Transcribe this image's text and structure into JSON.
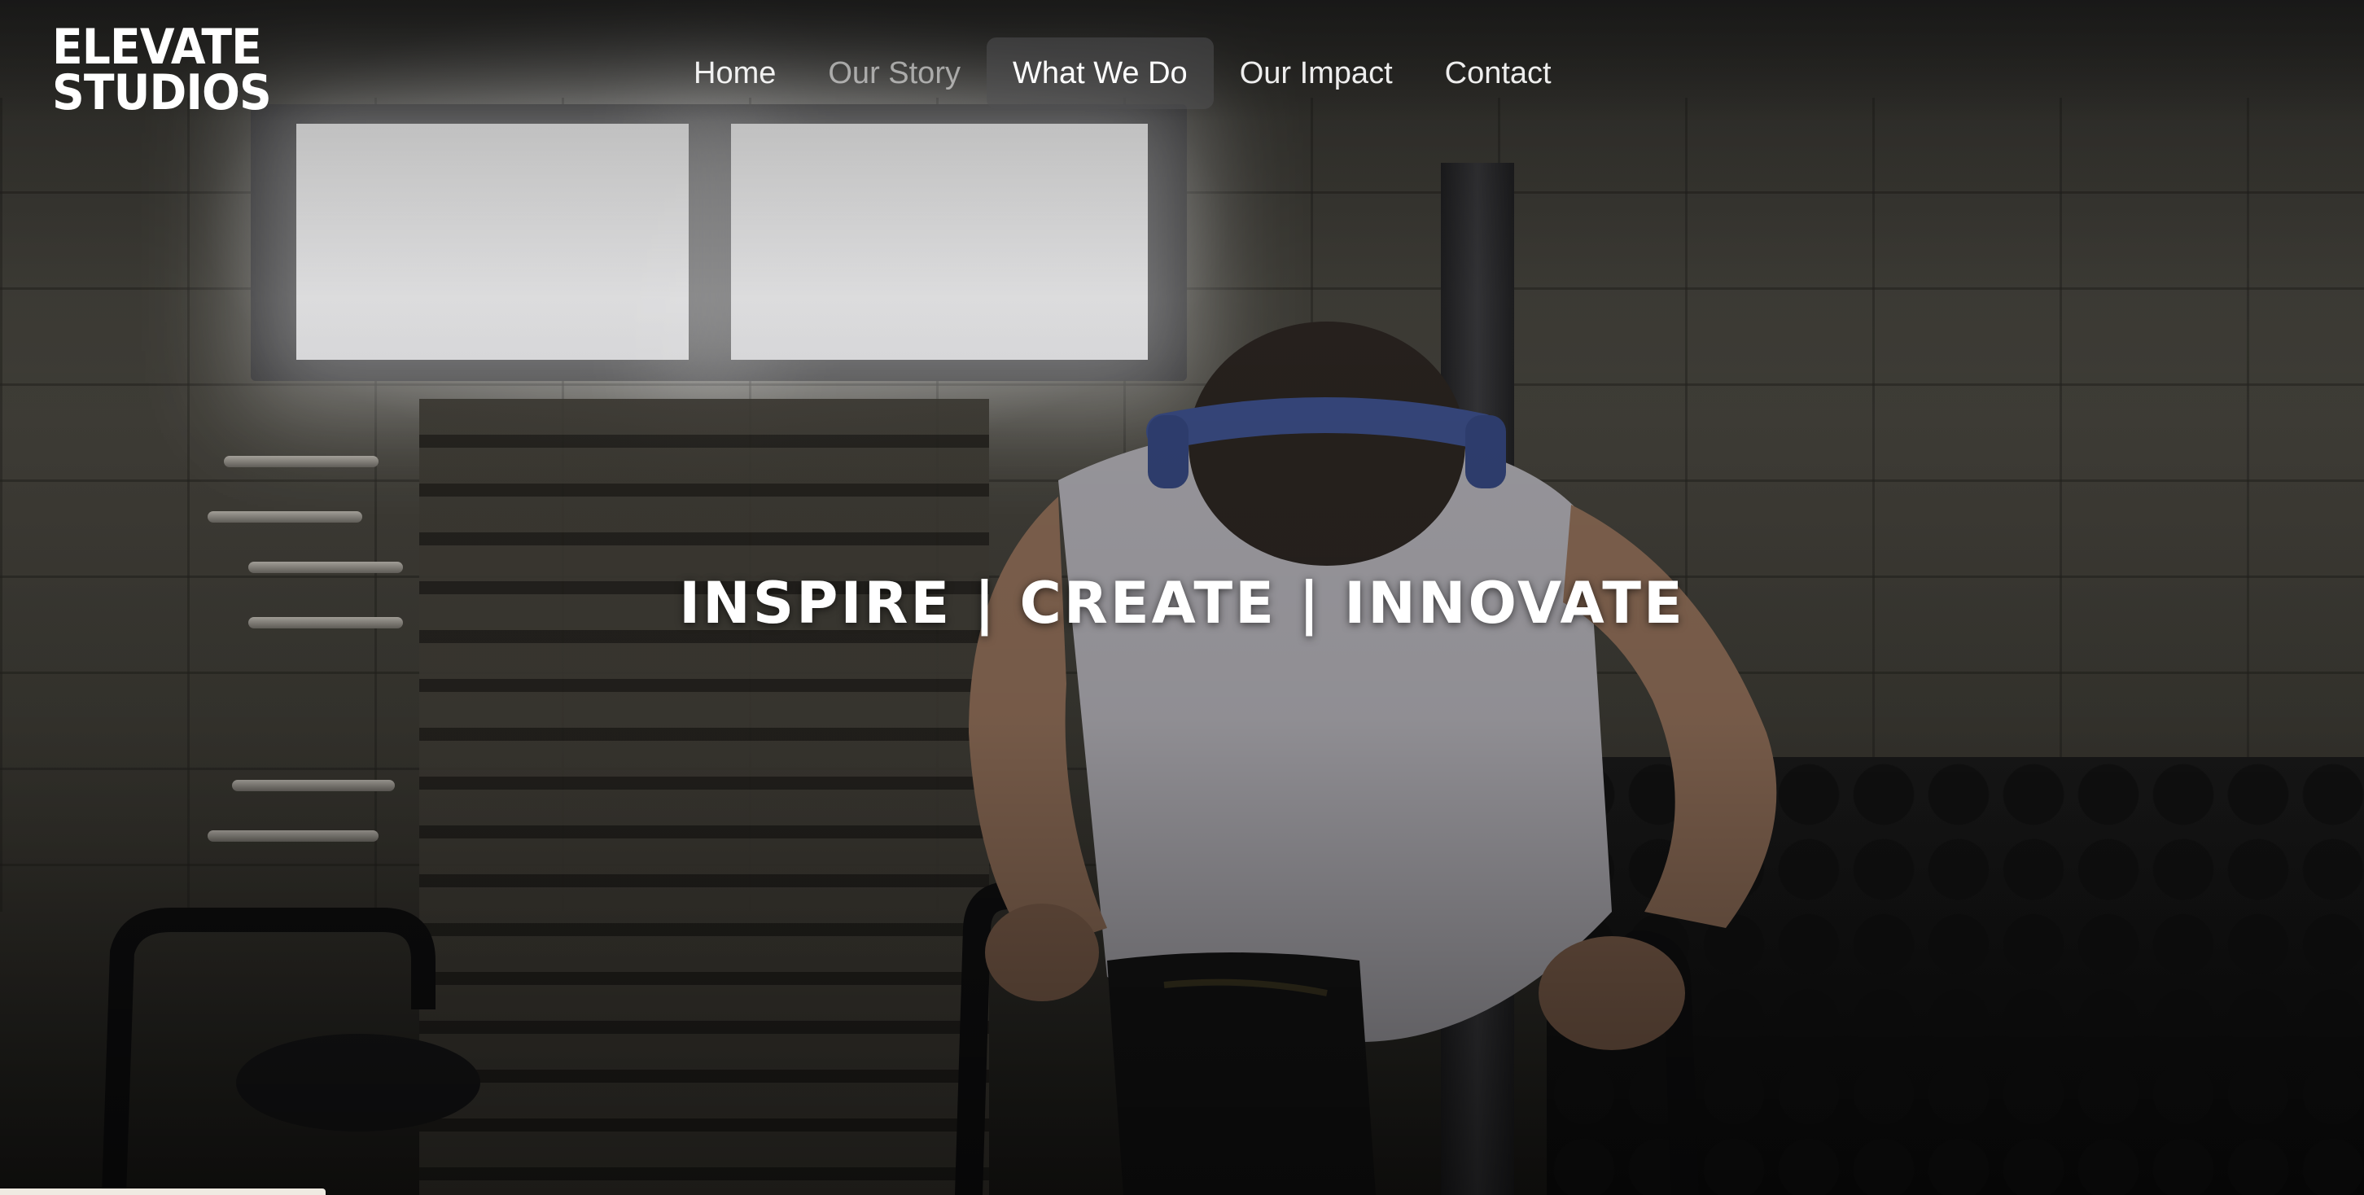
{
  "logo": {
    "line1": "ELEVATE",
    "line2": "STUDIOS"
  },
  "nav": {
    "items": [
      {
        "label": "Home"
      },
      {
        "label": "Our Story"
      },
      {
        "label": "What We Do"
      },
      {
        "label": "Our Impact"
      },
      {
        "label": "Contact"
      }
    ],
    "active": "What We Do"
  },
  "hero": {
    "tagline": "INSPIRE | CREATE | INNOVATE",
    "background": "gym-athlete-photo"
  },
  "colors": {
    "text": "#ffffff",
    "nav_active_bg": "#505052"
  }
}
